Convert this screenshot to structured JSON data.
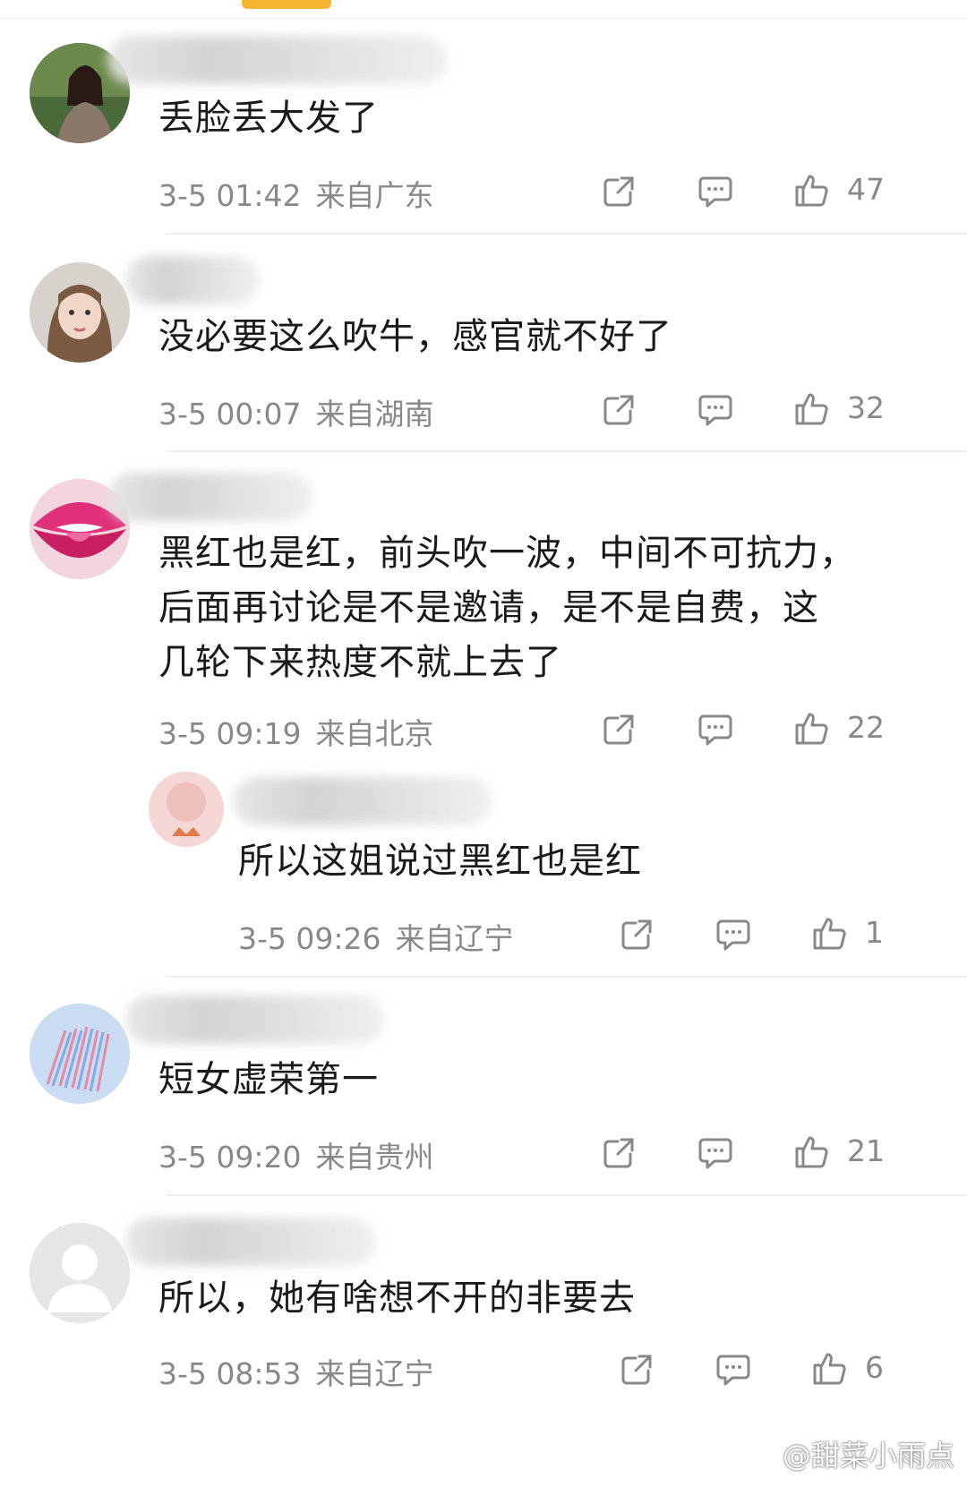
{
  "comments": [
    {
      "text": "丢脸丢大发了",
      "time": "3-5 01:42",
      "location": "来自广东",
      "likes": "47"
    },
    {
      "text": "没必要这么吹牛，感官就不好了",
      "time": "3-5 00:07",
      "location": "来自湖南",
      "likes": "32"
    },
    {
      "text_lines": [
        "黑红也是红，前头吹一波，中间不可抗力，",
        "后面再讨论是不是邀请，是不是自费，这",
        "几轮下来热度不就上去了"
      ],
      "time": "3-5 09:19",
      "location": "来自北京",
      "likes": "22",
      "reply": {
        "text": "所以这姐说过黑红也是红",
        "time": "3-5 09:26",
        "location": "来自辽宁",
        "likes": "1"
      }
    },
    {
      "text": "短女虚荣第一",
      "time": "3-5 09:20",
      "location": "来自贵州",
      "likes": "21"
    },
    {
      "text": "所以，她有啥想不开的非要去",
      "time": "3-5 08:53",
      "location": "来自辽宁",
      "likes": "6"
    }
  ],
  "watermark": "@甜菜小雨点",
  "icons": {
    "share": "share-icon",
    "comment": "comment-icon",
    "like": "thumbs-up-icon",
    "watermark": "weibo-logo-icon"
  },
  "colors": {
    "accent": "#f5b731",
    "meta": "#888888",
    "text": "#1a1a1a",
    "divider": "#eeeeee"
  }
}
